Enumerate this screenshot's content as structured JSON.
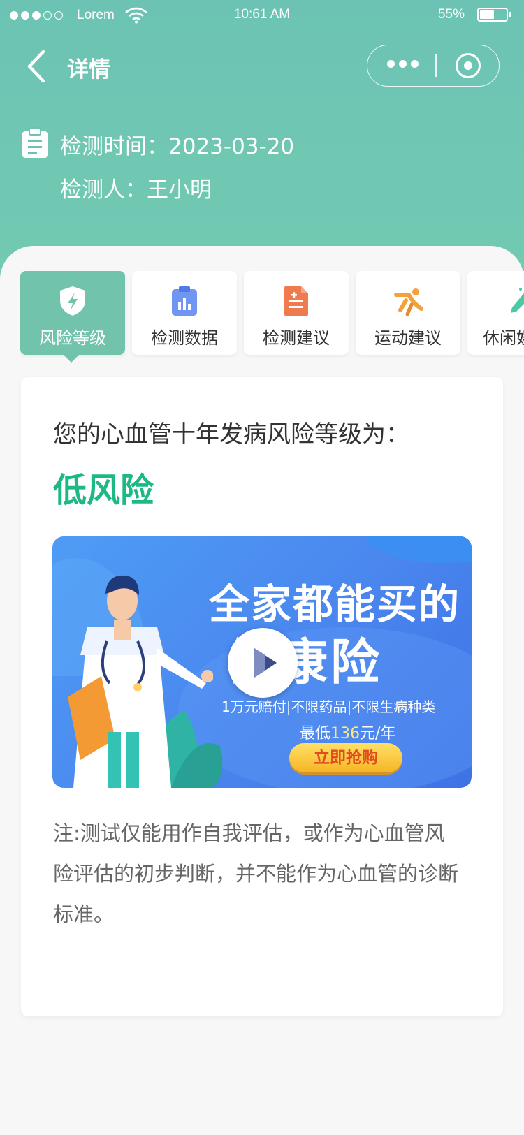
{
  "status_bar": {
    "carrier": "Lorem",
    "time": "10:61 AM",
    "battery_percent": "55%",
    "battery_level": 0.55
  },
  "nav": {
    "title": "详情",
    "back_icon": "chevron-left-icon",
    "more_icon": "more-dots-icon",
    "close_icon": "target-circle-icon"
  },
  "info": {
    "time_line": "检测时间：2023-03-20",
    "person_line": "检测人：王小明"
  },
  "tabs": [
    {
      "label": "风险等级",
      "icon": "shield-bolt-icon",
      "active": true
    },
    {
      "label": "检测数据",
      "icon": "clipboard-chart-icon",
      "active": false
    },
    {
      "label": "检测建议",
      "icon": "document-plus-icon",
      "active": false
    },
    {
      "label": "运动建议",
      "icon": "runner-icon",
      "active": false
    },
    {
      "label": "休闲娱",
      "icon": "pen-sparkle-icon",
      "active": false
    }
  ],
  "result": {
    "heading": "您的心血管十年发病风险等级为：",
    "level": "低风险"
  },
  "banner": {
    "title_line1": "全家都能买的",
    "title_line2": "健康险",
    "subtitle": "1万元赔付|不限药品|不限生病种类",
    "price_prefix": "最低",
    "price_value": "136",
    "price_suffix": "元/年",
    "button_label": "立即抢购"
  },
  "note": "注:测试仅能用作自我评估，或作为心血管风险评估的初步判断，并不能作为心血管的诊断标准。",
  "colors": {
    "header": "#6cc3b3",
    "accent": "#71c3ab",
    "risk_low": "#1db985"
  }
}
